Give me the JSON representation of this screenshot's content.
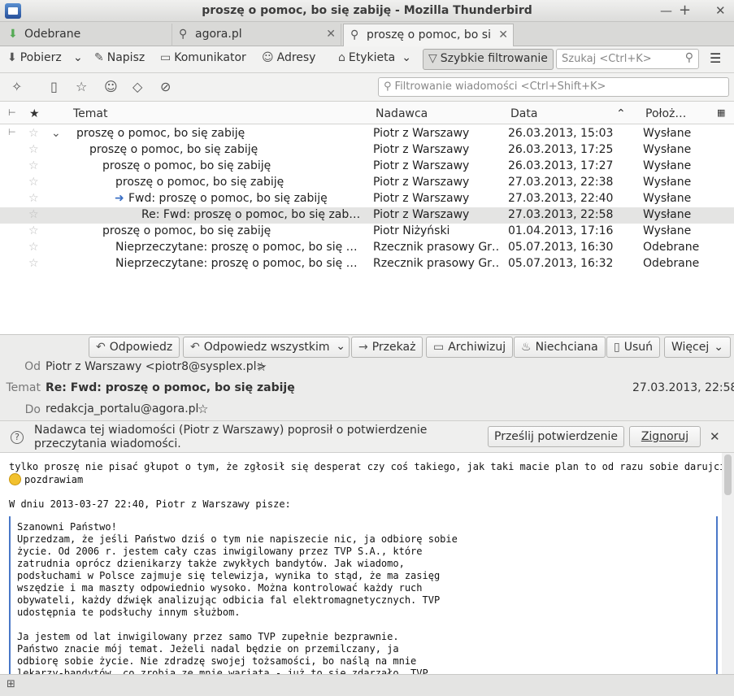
{
  "window": {
    "title": "proszę o pomoc, bo się zabiję - Mozilla Thunderbird"
  },
  "tabs": [
    {
      "label": "Odebrane"
    },
    {
      "label": "agora.pl"
    },
    {
      "label": "proszę o pomoc, bo się zabiję"
    }
  ],
  "toolbar": {
    "get": "Pobierz",
    "write": "Napisz",
    "chat": "Komunikator",
    "addressbook": "Adresy",
    "tag": "Etykieta",
    "quickfilter": "Szybkie filtrowanie",
    "search_placeholder": "Szukaj <Ctrl+K>"
  },
  "quickfilter": {
    "placeholder": "Filtrowanie wiadomości <Ctrl+Shift+K>"
  },
  "columns": {
    "subject": "Temat",
    "sender": "Nadawca",
    "date": "Data",
    "location": "Położ…"
  },
  "messages": [
    {
      "subject": "proszę o pomoc, bo się zabiję",
      "sender": "Piotr z Warszawy",
      "date": "26.03.2013, 15:03",
      "location": "Wysłane"
    },
    {
      "subject": "proszę o pomoc, bo się zabiję",
      "sender": "Piotr z Warszawy",
      "date": "26.03.2013, 17:25",
      "location": "Wysłane"
    },
    {
      "subject": "proszę o pomoc, bo się zabiję",
      "sender": "Piotr z Warszawy",
      "date": "26.03.2013, 17:27",
      "location": "Wysłane"
    },
    {
      "subject": "proszę o pomoc, bo się zabiję",
      "sender": "Piotr z Warszawy",
      "date": "27.03.2013, 22:38",
      "location": "Wysłane"
    },
    {
      "subject": "Fwd: proszę o pomoc, bo się zabiję",
      "sender": "Piotr z Warszawy",
      "date": "27.03.2013, 22:40",
      "location": "Wysłane"
    },
    {
      "subject": "Re: Fwd: proszę o pomoc, bo się zabiję",
      "sender": "Piotr z Warszawy",
      "date": "27.03.2013, 22:58",
      "location": "Wysłane"
    },
    {
      "subject": "proszę o pomoc, bo się zabiję",
      "sender": "Piotr Niżyński",
      "date": "01.04.2013, 17:16",
      "location": "Wysłane"
    },
    {
      "subject": "Nieprzeczytane: proszę o pomoc, bo się za…",
      "sender": "Rzecznik prasowy Gr…",
      "date": "05.07.2013, 16:30",
      "location": "Odebrane"
    },
    {
      "subject": "Nieprzeczytane: proszę o pomoc, bo się za…",
      "sender": "Rzecznik prasowy Gr…",
      "date": "05.07.2013, 16:32",
      "location": "Odebrane"
    }
  ],
  "msg_actions": {
    "reply": "Odpowiedz",
    "reply_all": "Odpowiedz wszystkim",
    "forward": "Przekaż",
    "archive": "Archiwizuj",
    "junk": "Niechciana",
    "delete": "Usuń",
    "more": "Więcej"
  },
  "header": {
    "from_label": "Od",
    "from": "Piotr z Warszawy <piotr8@sysplex.pl>",
    "subject_label": "Temat",
    "subject": "Re: Fwd: proszę o pomoc, bo się zabiję",
    "date": "27.03.2013, 22:58",
    "to_label": "Do",
    "to": "redakcja_portalu@agora.pl"
  },
  "notification": {
    "text": "Nadawca tej wiadomości (Piotr z Warszawy) poprosił o potwierdzenie przeczytania wiadomości.",
    "send": "Prześlij potwierdzenie",
    "ignore": "Zignoruj"
  },
  "body": {
    "line1": "tylko proszę nie pisać głupot o tym, że zgłosił się desperat czy coś takiego, jak taki macie plan to od razu sobie darujcie",
    "line2": "pozdrawiam",
    "attribution": "W dniu 2013-03-27 22:40, Piotr z Warszawy pisze:",
    "quote": "Szanowni Państwo!\nUprzedzam, że jeśli Państwo dziś o tym nie napiszecie nic, ja odbiorę sobie\nżycie. Od 2006 r. jestem cały czas inwigilowany przez TVP S.A., które\nzatrudnia oprócz dzienikarzy także zwykłych bandytów. Jak wiadomo,\npodsłuchami w Polsce zajmuje się telewizja, wynika to stąd, że ma zasięg\nwszędzie i ma maszty odpowiednio wysoko. Można kontrolować każdy ruch\nobywateli, każdy dźwięk analizując odbicia fal elektromagnetycznych. TVP\nudostępnia te podsłuchy innym służbom.\n\nJa jestem od lat inwigilowany przez samo TVP zupełnie bezprawnie.\nPaństwo znacie mój temat. Jeżeli nadal będzie on przemilczany, ja\nodbiorę sobie życie. Nie zdradzę swojej tożsamości, bo naślą na mnie\nlekarzy-bandytów, co zrobią ze mnie wariata - już to się zdarzało. TVP"
  }
}
